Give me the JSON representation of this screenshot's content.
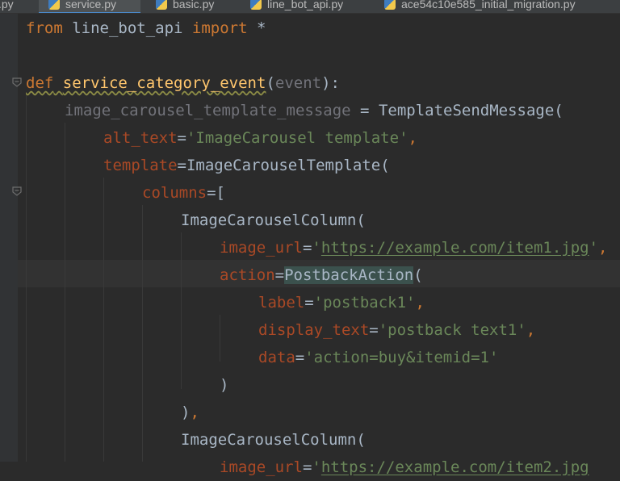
{
  "tabs": [
    {
      "label": ".py",
      "active": false
    },
    {
      "label": "service.py",
      "active": true
    },
    {
      "label": "basic.py",
      "active": false
    },
    {
      "label": "line_bot_api.py",
      "active": false
    },
    {
      "label": "ace54c10e585_initial_migration.py",
      "active": false
    }
  ],
  "code": {
    "l1": {
      "kw_from": "from",
      "module": " line_bot_api ",
      "kw_import": "import",
      "rest": " *"
    },
    "l3": {
      "kw_def": "def",
      "space": " ",
      "fname": "service_category_event",
      "open": "(",
      "param": "event",
      "close": "):"
    },
    "l4": {
      "var": "image_carousel_template_message",
      "eq": " = ",
      "cls": "TemplateSendMessage",
      "open": "("
    },
    "l5": {
      "arg": "alt_text",
      "eq": "=",
      "str": "'ImageCarousel template'",
      "comma": ","
    },
    "l6": {
      "arg": "template",
      "eq": "=",
      "cls": "ImageCarouselTemplate",
      "open": "("
    },
    "l7": {
      "arg": "columns",
      "eq": "=",
      "open": "["
    },
    "l8": {
      "cls": "ImageCarouselColumn",
      "open": "("
    },
    "l9": {
      "arg": "image_url",
      "eq": "=",
      "q": "'",
      "url": "https://example.com/item1.jpg",
      "q2": "'",
      "comma": ","
    },
    "l10": {
      "arg": "action",
      "eq": "=",
      "cls": "PostbackAction",
      "open": "("
    },
    "l11": {
      "arg": "label",
      "eq": "=",
      "str": "'postback1'",
      "comma": ","
    },
    "l12": {
      "arg": "display_text",
      "eq": "=",
      "str": "'postback text1'",
      "comma": ","
    },
    "l13": {
      "arg": "data",
      "eq": "=",
      "str": "'action=buy&itemid=1'"
    },
    "l14": {
      "close": ")"
    },
    "l15": {
      "close": ")",
      "comma": ","
    },
    "l16": {
      "cls": "ImageCarouselColumn",
      "open": "("
    },
    "l17": {
      "arg": "image_url",
      "eq": "=",
      "q": "'",
      "url": "https://example.com/item2.jpg"
    }
  },
  "colors": {
    "background": "#2b2b2b",
    "keyword": "#cc7832",
    "function": "#ffc66d",
    "string": "#6a8759",
    "parameter": "#aa4926",
    "text": "#a9b7c6"
  }
}
